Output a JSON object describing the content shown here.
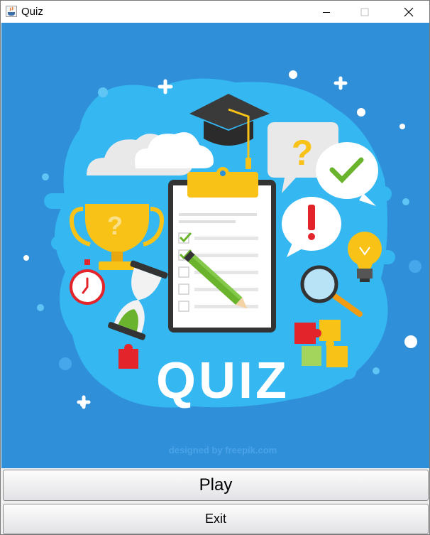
{
  "window": {
    "title": "Quiz"
  },
  "illustration": {
    "heading": "QUIZ",
    "credit": "designed by freepik.com",
    "icons": [
      "graduation-cap-icon",
      "cloud-icon",
      "question-bubble-icon",
      "check-bubble-icon",
      "exclamation-bubble-icon",
      "trophy-icon",
      "stopwatch-icon",
      "hourglass-icon",
      "clipboard-icon",
      "pencil-icon",
      "lightbulb-icon",
      "magnifier-icon",
      "puzzle-icon"
    ],
    "colors": {
      "background": "#2f8fd9",
      "splash": "#35b7f2",
      "yellow": "#f8c217",
      "green": "#6ab42d",
      "red": "#e3242b"
    }
  },
  "buttons": {
    "play": "Play",
    "exit": "Exit"
  }
}
